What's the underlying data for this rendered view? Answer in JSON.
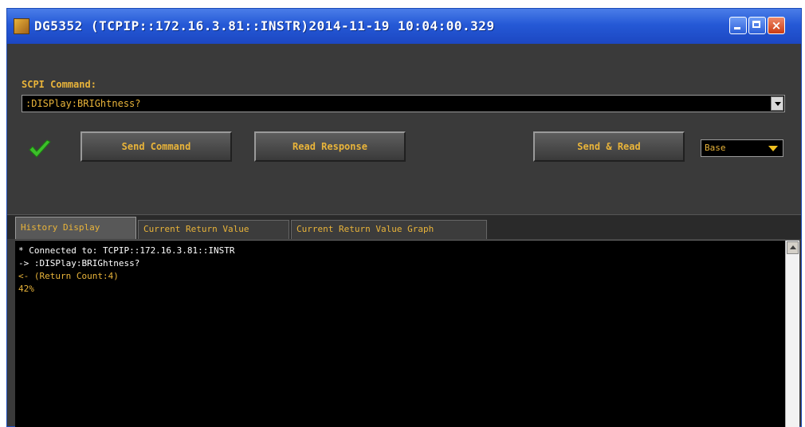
{
  "window": {
    "title": "DG5352 (TCPIP::172.16.3.81::INSTR)2014-11-19 10:04:00.329"
  },
  "scpi": {
    "label": "SCPI Command:",
    "command_value": ":DISPlay:BRIGhtness?"
  },
  "buttons": {
    "send": "Send Command",
    "read": "Read Response",
    "send_read": "Send & Read"
  },
  "format_select": {
    "value": "Base"
  },
  "tabs": [
    {
      "label": "History Display",
      "active": true
    },
    {
      "label": "Current Return Value",
      "active": false
    },
    {
      "label": "Current Return Value Graph",
      "active": false
    }
  ],
  "history": {
    "lines": [
      "* Connected to: TCPIP::172.16.3.81::INSTR",
      "-> :DISPlay:BRIGhtness?",
      "<- (Return Count:4)",
      "42%"
    ]
  },
  "colors": {
    "title_bar": "#2559d6",
    "window_bg": "#3a3a3a",
    "accent_text": "#e9b43a",
    "console_bg": "#000000",
    "check": "#3cbf2a"
  },
  "icons": {
    "app": "app-icon",
    "minimize": "minimize-icon",
    "maximize": "maximize-icon",
    "close": "close-icon",
    "status": "check-icon",
    "dropdown": "chevron-down-icon"
  }
}
